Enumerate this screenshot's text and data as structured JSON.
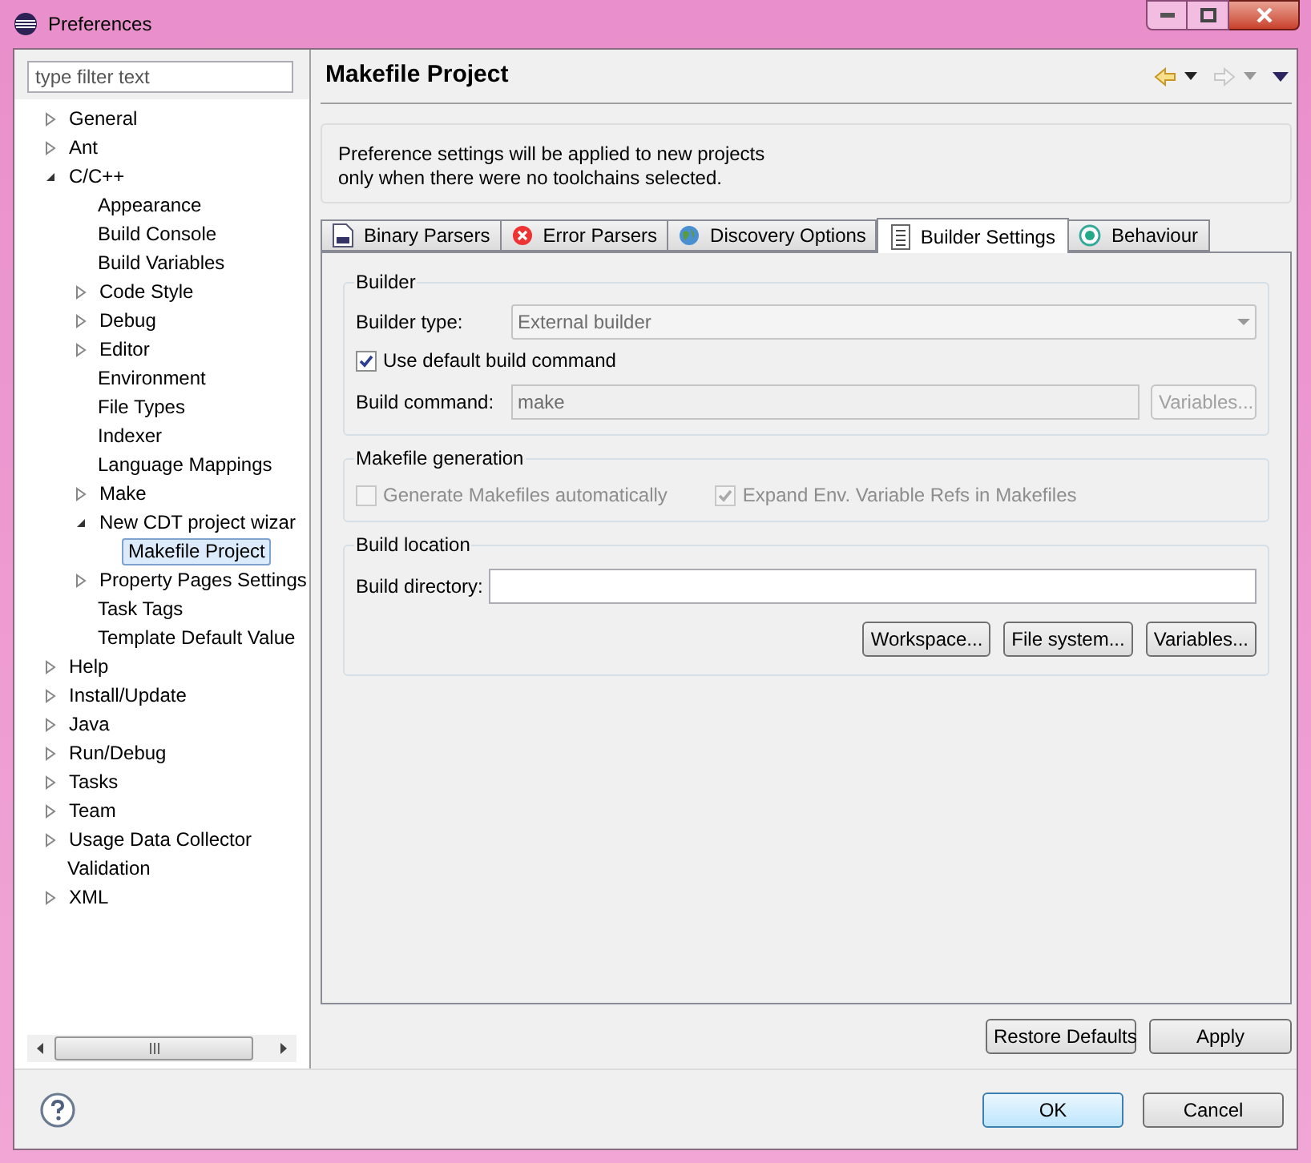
{
  "window": {
    "title": "Preferences"
  },
  "filter": {
    "placeholder": "type filter text"
  },
  "tree": [
    {
      "label": "General",
      "expanded": false,
      "selected": false
    },
    {
      "label": "Ant",
      "expanded": false,
      "selected": false
    },
    {
      "label": "C/C++",
      "expanded": true,
      "selected": false,
      "children": [
        {
          "label": "Appearance",
          "selected": false
        },
        {
          "label": "Build Console",
          "selected": false
        },
        {
          "label": "Build Variables",
          "selected": false
        },
        {
          "label": "Code Style",
          "expanded": false,
          "selected": false
        },
        {
          "label": "Debug",
          "expanded": false,
          "selected": false
        },
        {
          "label": "Editor",
          "expanded": false,
          "selected": false
        },
        {
          "label": "Environment",
          "selected": false
        },
        {
          "label": "File Types",
          "selected": false
        },
        {
          "label": "Indexer",
          "selected": false
        },
        {
          "label": "Language Mappings",
          "selected": false
        },
        {
          "label": "Make",
          "expanded": false,
          "selected": false
        },
        {
          "label": "New CDT project wizar",
          "expanded": true,
          "selected": false,
          "children": [
            {
              "label": "Makefile Project",
              "selected": true
            }
          ]
        },
        {
          "label": "Property Pages Settings",
          "expanded": false,
          "selected": false
        },
        {
          "label": "Task Tags",
          "selected": false
        },
        {
          "label": "Template Default Value",
          "selected": false
        }
      ]
    },
    {
      "label": "Help",
      "expanded": false,
      "selected": false
    },
    {
      "label": "Install/Update",
      "expanded": false,
      "selected": false
    },
    {
      "label": "Java",
      "expanded": false,
      "selected": false
    },
    {
      "label": "Run/Debug",
      "expanded": false,
      "selected": false
    },
    {
      "label": "Tasks",
      "expanded": false,
      "selected": false
    },
    {
      "label": "Team",
      "expanded": false,
      "selected": false
    },
    {
      "label": "Usage Data Collector",
      "expanded": false,
      "selected": false
    },
    {
      "label": "Validation",
      "selected": false
    },
    {
      "label": "XML",
      "expanded": false,
      "selected": false
    }
  ],
  "page": {
    "title": "Makefile Project",
    "info": [
      "Preference settings will be applied to new projects",
      "only when there were no toolchains selected."
    ],
    "tabs": [
      {
        "label": "Binary Parsers",
        "kind": "binary",
        "selected": false
      },
      {
        "label": "Error Parsers",
        "kind": "error",
        "selected": false
      },
      {
        "label": "Discovery Options",
        "kind": "globe",
        "selected": false
      },
      {
        "label": "Builder Settings",
        "kind": "list",
        "selected": true
      },
      {
        "label": "Behaviour",
        "kind": "radio",
        "selected": false
      }
    ],
    "builder": {
      "title": "Builder",
      "type_label": "Builder type:",
      "type_value": "External builder",
      "type_disabled": true,
      "default_cmd": {
        "label": "Use default build command",
        "checked": true,
        "disabled": false
      },
      "cmd_label": "Build command:",
      "cmd_value": "make",
      "cmd_disabled": true,
      "variables": {
        "label": "Variables...",
        "disabled": true
      }
    },
    "generation": {
      "title": "Makefile generation",
      "options": [
        {
          "label": "Generate Makefiles automatically",
          "checked": false,
          "disabled": true
        },
        {
          "label": "Expand Env. Variable Refs in Makefiles",
          "checked": true,
          "disabled": true
        }
      ]
    },
    "location": {
      "title": "Build location",
      "dir_label": "Build directory:",
      "buttons": [
        "Workspace...",
        "File system...",
        "Variables..."
      ]
    },
    "restore": "Restore Defaults",
    "apply": "Apply"
  },
  "buttons": [
    {
      "label": "OK",
      "default": true
    },
    {
      "label": "Cancel",
      "default": false
    }
  ]
}
